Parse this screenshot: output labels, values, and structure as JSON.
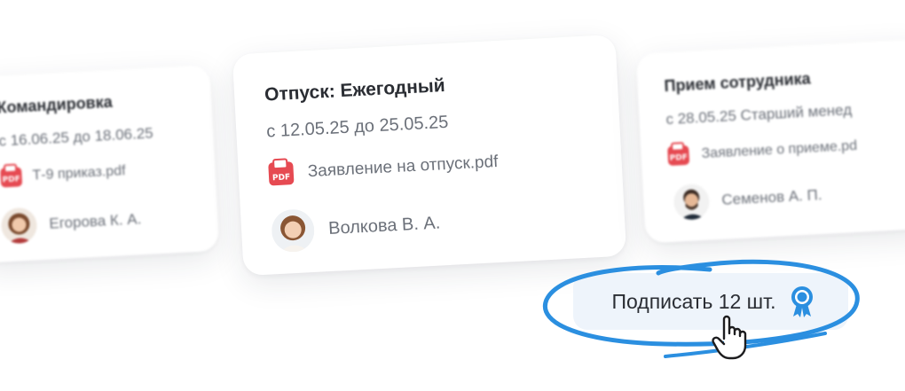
{
  "cards": [
    {
      "title": "Командировка",
      "dates": "с 16.06.25 до 18.06.25",
      "file": "Т-9 приказ.pdf",
      "person": "Егорова К. А."
    },
    {
      "title": "Отпуск: Ежегодный",
      "dates": "с 12.05.25 до 25.05.25",
      "file": "Заявление на отпуск.pdf",
      "person": "Волкова В. А."
    },
    {
      "title": "Прием сотрудника",
      "dates": "с 28.05.25 Старший менед",
      "file": "Заявление о приеме.pd",
      "person": "Семенов А. П."
    }
  ],
  "pdf_icon_label": "PDF",
  "sign_button": {
    "label": "Подписать 12 шт."
  },
  "colors": {
    "accent": "#2b8fe0",
    "pdf": "#e64a52",
    "button_bg": "#eef4fb"
  }
}
